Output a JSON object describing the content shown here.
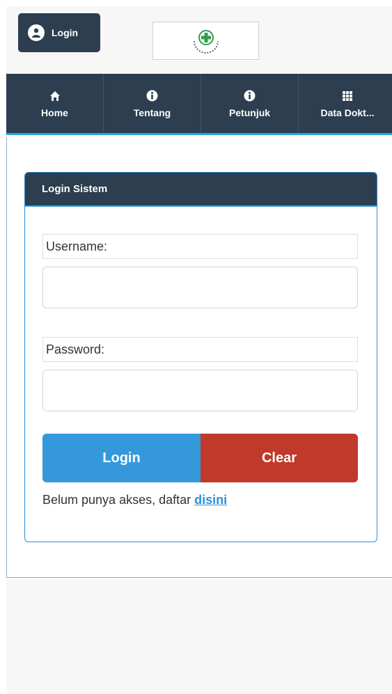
{
  "header": {
    "login_label": "Login"
  },
  "nav": {
    "items": [
      {
        "label": "Home",
        "icon": "home-icon"
      },
      {
        "label": "Tentang",
        "icon": "info-icon"
      },
      {
        "label": "Petunjuk",
        "icon": "info-icon"
      },
      {
        "label": "Data Dokt...",
        "icon": "grid-icon"
      }
    ]
  },
  "panel": {
    "title": "Login Sistem",
    "username_label": "Username:",
    "username_value": "",
    "password_label": "Password:",
    "password_value": "",
    "login_button": "Login",
    "clear_button": "Clear",
    "register_text": "Belum punya akses, daftar ",
    "register_link": "disini"
  },
  "colors": {
    "navy": "#2c3e50",
    "accent": "#25a3d8",
    "login_button": "#3498db",
    "clear_button": "#c0392b"
  }
}
